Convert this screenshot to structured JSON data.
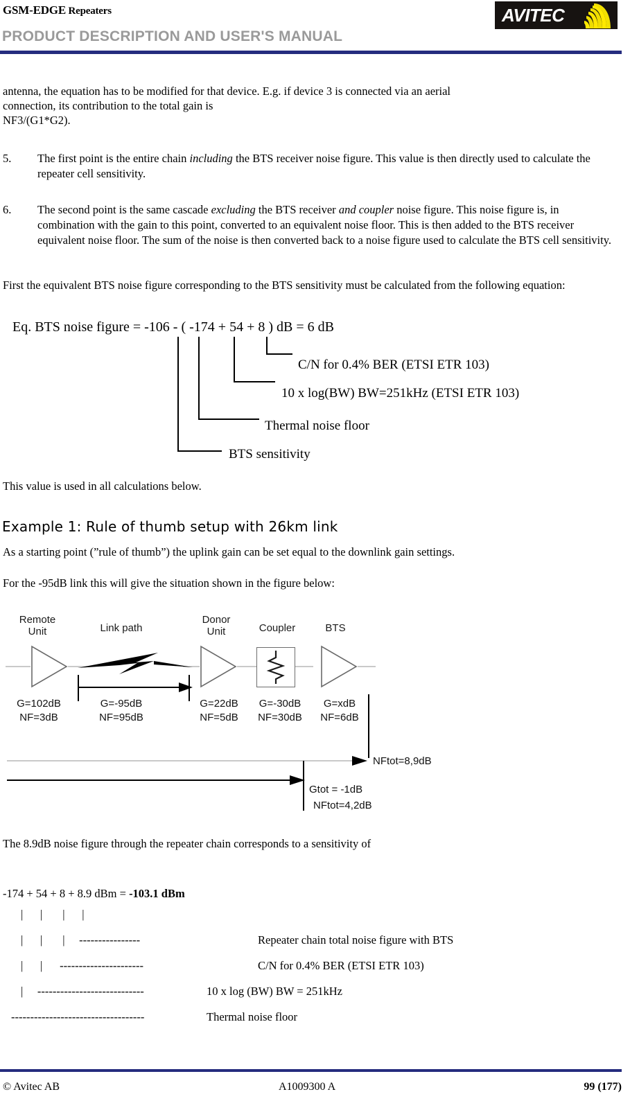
{
  "header": {
    "doc_type_strong": "GSM-EDGE",
    "doc_type_rest": " Repeaters",
    "subtitle": "PRODUCT DESCRIPTION AND USER'S MANUAL",
    "logo_text": "AVITEC",
    "rule_color": "#252c7e"
  },
  "footer": {
    "copyright": "© Avitec AB",
    "doc_number": "A1009300 A",
    "page": "99 (177)"
  },
  "body": {
    "intro_line1": "antenna, the equation has to be modified for that device. E.g. if device 3 is connected via an aerial",
    "intro_line2": "connection, its contribution to the total gain is",
    "intro_line3": "NF3/(G1*G2).",
    "item5_num": "5.",
    "item5_a": "The first point is the entire chain ",
    "item5_em": "including",
    "item5_b": " the BTS receiver noise figure. This value is then directly used to calculate the repeater cell sensitivity.",
    "item6_num": "6.",
    "item6_a": "The second point is the same cascade ",
    "item6_em1": "excluding",
    "item6_b": " the BTS receiver ",
    "item6_em2": "and coupler",
    "item6_c": " noise figure. This noise figure is, in combination with the gain to this point, converted to an equivalent noise floor. This is then added to the BTS receiver equivalent noise floor. The sum of the noise is then converted back to a noise figure used to calculate the BTS cell sensitivity.",
    "para_first_eq": "First the equivalent BTS noise figure corresponding to the BTS sensitivity must be calculated from the following equation:",
    "para_value_used": "This value is used in all calculations below.",
    "heading_example1": "Example 1: Rule of thumb setup with 26km link",
    "para_starting_point": "As a starting point (”rule of thumb”) the uplink gain can be set equal to the downlink gain settings.",
    "para_95db": "For the -95dB link this will give the situation shown in the figure below:",
    "para_89db": "The 8.9dB noise figure through the repeater chain corresponds to a sensitivity of"
  },
  "equation": {
    "text": "Eq. BTS noise figure = -106 - ( -174 + 54 + 8 ) dB = 6 dB",
    "callouts": [
      {
        "label": "C/N for 0.4% BER (ETSI ETR 103)"
      },
      {
        "label": "10 x log(BW) BW=251kHz (ETSI ETR 103)"
      },
      {
        "label": "Thermal noise floor"
      },
      {
        "label": "BTS sensitivity"
      }
    ]
  },
  "diagram": {
    "stages": [
      {
        "title_line1": "Remote",
        "title_line2": "Unit",
        "gain": "G=102dB",
        "nf": "NF=3dB"
      },
      {
        "title_line1": "Link path",
        "title_line2": "",
        "gain": "G=-95dB",
        "nf": "NF=95dB"
      },
      {
        "title_line1": "Donor",
        "title_line2": "Unit",
        "gain": "G=22dB",
        "nf": "NF=5dB"
      },
      {
        "title_line1": "Coupler",
        "title_line2": "",
        "gain": "G=-30dB",
        "nf": "NF=30dB"
      },
      {
        "title_line1": "BTS",
        "title_line2": "",
        "gain": "G=xdB",
        "nf": "NF=6dB"
      }
    ],
    "nftot_full": "NFtot=8,9dB",
    "gtot_partial": "Gtot = -1dB",
    "nftot_partial": "NFtot=4,2dB"
  },
  "sensitivity": {
    "equation_prefix": "-174 + 54 + 8 + 8.9 dBm = ",
    "equation_result": "-103.1 dBm",
    "rows": [
      {
        "art": "|      |       |      |",
        "label": ""
      },
      {
        "art": "|      |       |     ----------------",
        "label": "Repeater chain total noise figure with BTS"
      },
      {
        "art": "|      |      ----------------------",
        "label": "C/N for 0.4% BER (ETSI ETR 103)"
      },
      {
        "art": "|     ----------------------------",
        "label": "10 x log (BW) BW = 251kHz"
      },
      {
        "art": "-----------------------------------",
        "label": "Thermal noise floor"
      }
    ]
  }
}
